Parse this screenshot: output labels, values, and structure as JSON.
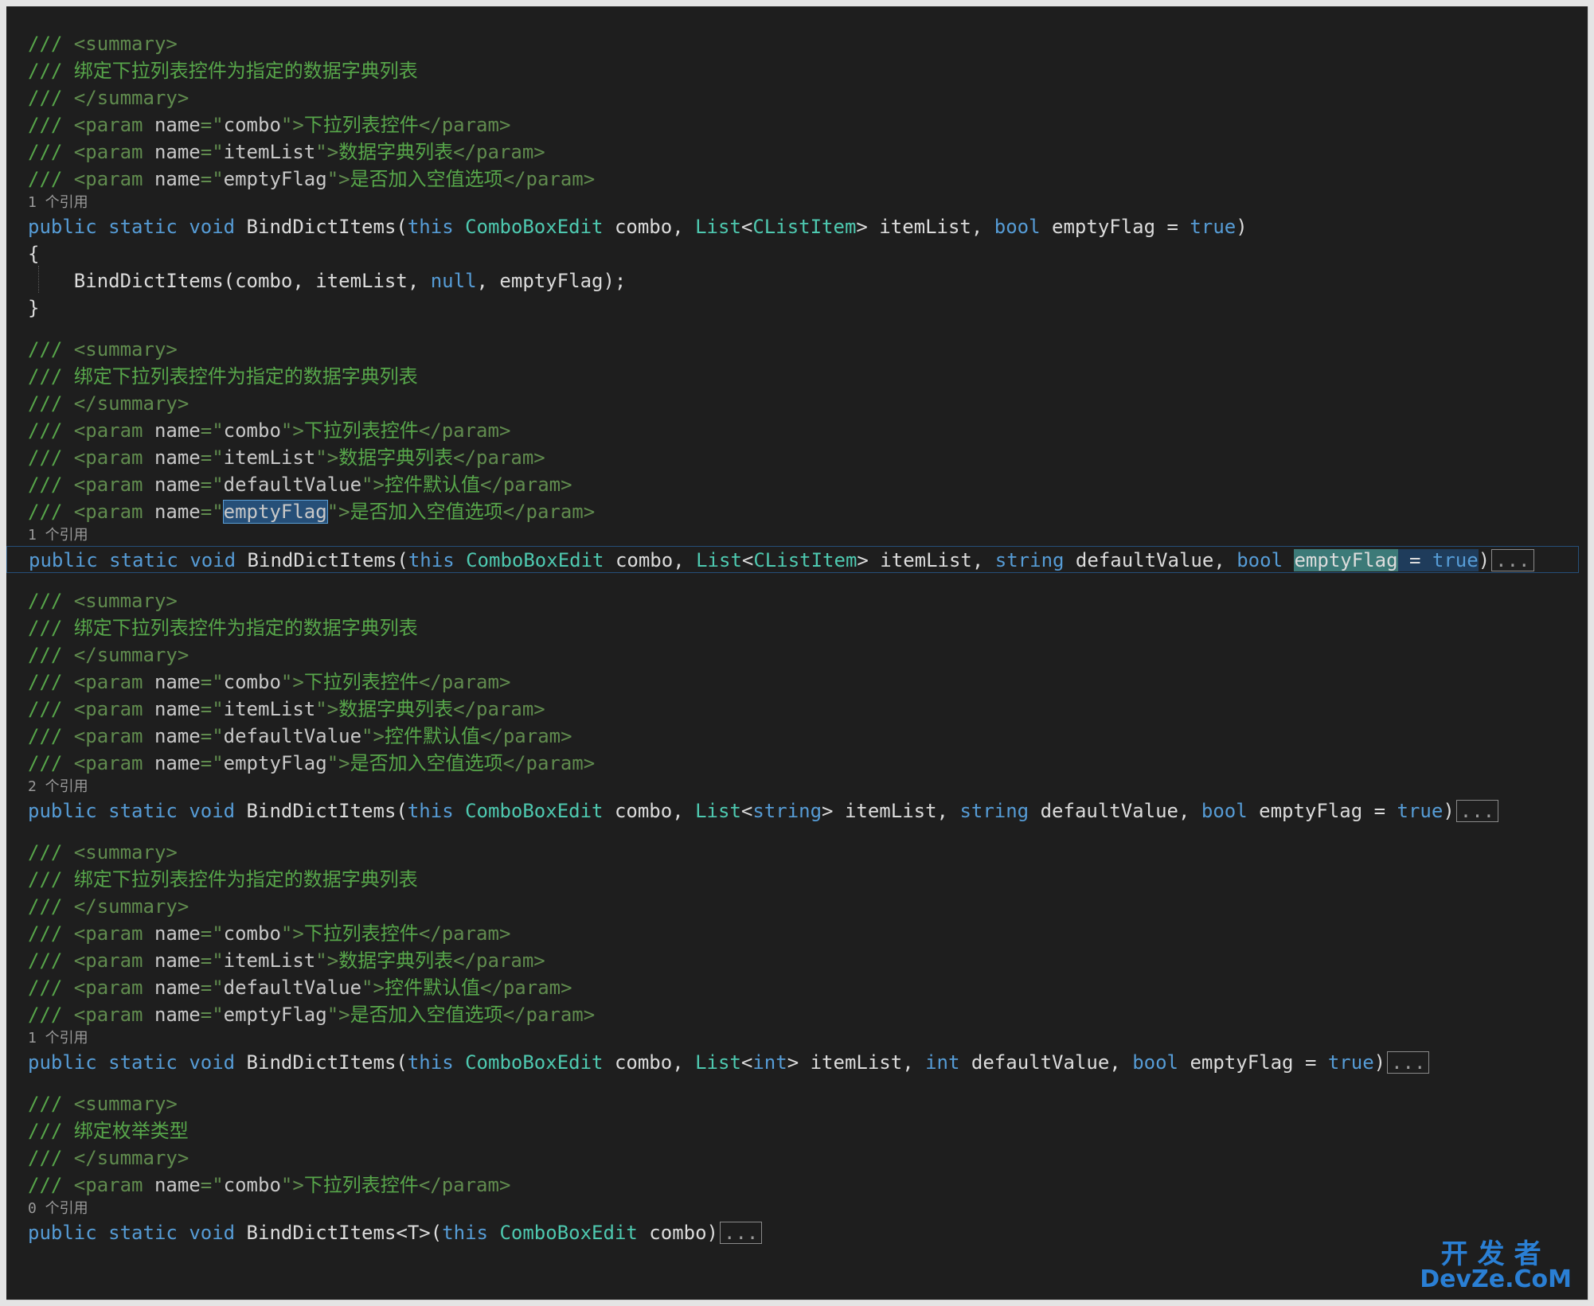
{
  "code_lines": [
    {
      "tokens": [
        [
          "c-comment",
          "/// "
        ],
        [
          "c-xmltag",
          "<summary>"
        ]
      ]
    },
    {
      "tokens": [
        [
          "c-comment",
          "/// 绑定下拉列表控件为指定的数据字典列表"
        ]
      ]
    },
    {
      "tokens": [
        [
          "c-comment",
          "/// "
        ],
        [
          "c-xmltag",
          "</summary>"
        ]
      ]
    },
    {
      "tokens": [
        [
          "c-comment",
          "/// "
        ],
        [
          "c-xmltag",
          "<param "
        ],
        [
          "c-attrname",
          "name"
        ],
        [
          "c-xmltag",
          "=\""
        ],
        [
          "c-attrval",
          "combo"
        ],
        [
          "c-xmltag",
          "\">"
        ],
        [
          "c-comment",
          "下拉列表控件"
        ],
        [
          "c-xmltag",
          "</param>"
        ]
      ]
    },
    {
      "tokens": [
        [
          "c-comment",
          "/// "
        ],
        [
          "c-xmltag",
          "<param "
        ],
        [
          "c-attrname",
          "name"
        ],
        [
          "c-xmltag",
          "=\""
        ],
        [
          "c-attrval",
          "itemList"
        ],
        [
          "c-xmltag",
          "\">"
        ],
        [
          "c-comment",
          "数据字典列表"
        ],
        [
          "c-xmltag",
          "</param>"
        ]
      ]
    },
    {
      "tokens": [
        [
          "c-comment",
          "/// "
        ],
        [
          "c-xmltag",
          "<param "
        ],
        [
          "c-attrname",
          "name"
        ],
        [
          "c-xmltag",
          "=\""
        ],
        [
          "c-attrval",
          "emptyFlag"
        ],
        [
          "c-xmltag",
          "\">"
        ],
        [
          "c-comment",
          "是否加入空值选项"
        ],
        [
          "c-xmltag",
          "</param>"
        ]
      ]
    },
    {
      "lens": "1 个引用"
    },
    {
      "tokens": [
        [
          "c-keyword",
          "public"
        ],
        [
          "c-ident",
          " "
        ],
        [
          "c-keyword",
          "static"
        ],
        [
          "c-ident",
          " "
        ],
        [
          "c-keyword",
          "void"
        ],
        [
          "c-ident",
          " BindDictItems("
        ],
        [
          "c-keyword",
          "this"
        ],
        [
          "c-ident",
          " "
        ],
        [
          "c-type",
          "ComboBoxEdit"
        ],
        [
          "c-ident",
          " combo, "
        ],
        [
          "c-type",
          "List"
        ],
        [
          "c-ident",
          "<"
        ],
        [
          "c-type",
          "CListItem"
        ],
        [
          "c-ident",
          "> itemList, "
        ],
        [
          "c-keyword",
          "bool"
        ],
        [
          "c-ident",
          " emptyFlag = "
        ],
        [
          "c-keyword",
          "true"
        ],
        [
          "c-ident",
          ")"
        ]
      ]
    },
    {
      "tokens": [
        [
          "c-ident",
          "{"
        ]
      ]
    },
    {
      "tokens": [
        [
          "c-ident",
          "    BindDictItems(combo, itemList, "
        ],
        [
          "c-keyword",
          "null"
        ],
        [
          "c-ident",
          ", emptyFlag);"
        ]
      ]
    },
    {
      "tokens": [
        [
          "c-ident",
          "}"
        ]
      ]
    },
    {
      "blank": true
    },
    {
      "tokens": [
        [
          "c-comment",
          "/// "
        ],
        [
          "c-xmltag",
          "<summary>"
        ]
      ]
    },
    {
      "tokens": [
        [
          "c-comment",
          "/// 绑定下拉列表控件为指定的数据字典列表"
        ]
      ]
    },
    {
      "tokens": [
        [
          "c-comment",
          "/// "
        ],
        [
          "c-xmltag",
          "</summary>"
        ]
      ]
    },
    {
      "tokens": [
        [
          "c-comment",
          "/// "
        ],
        [
          "c-xmltag",
          "<param "
        ],
        [
          "c-attrname",
          "name"
        ],
        [
          "c-xmltag",
          "=\""
        ],
        [
          "c-attrval",
          "combo"
        ],
        [
          "c-xmltag",
          "\">"
        ],
        [
          "c-comment",
          "下拉列表控件"
        ],
        [
          "c-xmltag",
          "</param>"
        ]
      ]
    },
    {
      "tokens": [
        [
          "c-comment",
          "/// "
        ],
        [
          "c-xmltag",
          "<param "
        ],
        [
          "c-attrname",
          "name"
        ],
        [
          "c-xmltag",
          "=\""
        ],
        [
          "c-attrval",
          "itemList"
        ],
        [
          "c-xmltag",
          "\">"
        ],
        [
          "c-comment",
          "数据字典列表"
        ],
        [
          "c-xmltag",
          "</param>"
        ]
      ]
    },
    {
      "tokens": [
        [
          "c-comment",
          "/// "
        ],
        [
          "c-xmltag",
          "<param "
        ],
        [
          "c-attrname",
          "name"
        ],
        [
          "c-xmltag",
          "=\""
        ],
        [
          "c-attrval",
          "defaultValue"
        ],
        [
          "c-xmltag",
          "\">"
        ],
        [
          "c-comment",
          "控件默认值"
        ],
        [
          "c-xmltag",
          "</param>"
        ]
      ]
    },
    {
      "tokens": [
        [
          "c-comment",
          "/// "
        ],
        [
          "c-xmltag",
          "<param "
        ],
        [
          "c-attrname",
          "name"
        ],
        [
          "c-xmltag",
          "=\""
        ],
        [
          "c-attrval c-hl-word",
          "emptyFlag"
        ],
        [
          "c-xmltag",
          "\">"
        ],
        [
          "c-comment",
          "是否加入空值选项"
        ],
        [
          "c-xmltag",
          "</param>"
        ]
      ]
    },
    {
      "lens": "1 个引用"
    },
    {
      "highlight": true,
      "collapsed": "...",
      "tokens": [
        [
          "c-keyword",
          "public"
        ],
        [
          "c-ident",
          " "
        ],
        [
          "c-keyword",
          "static"
        ],
        [
          "c-ident",
          " "
        ],
        [
          "c-keyword",
          "void"
        ],
        [
          "c-ident",
          " BindDictItems("
        ],
        [
          "c-keyword",
          "this"
        ],
        [
          "c-ident",
          " "
        ],
        [
          "c-type",
          "ComboBoxEdit"
        ],
        [
          "c-ident",
          " combo, "
        ],
        [
          "c-type",
          "List"
        ],
        [
          "c-ident",
          "<"
        ],
        [
          "c-type",
          "CListItem"
        ],
        [
          "c-ident",
          "> itemList, "
        ],
        [
          "c-keyword",
          "string"
        ],
        [
          "c-ident",
          " defaultValue, "
        ],
        [
          "c-keyword",
          "bool"
        ],
        [
          "c-ident",
          " "
        ],
        [
          "c-ident c-hl-def",
          "emptyFlag"
        ],
        [
          "c-ident c-hl-sel",
          " = "
        ],
        [
          "c-keyword c-hl-sel",
          "true"
        ],
        [
          "c-ident",
          ")"
        ]
      ]
    },
    {
      "blank": true
    },
    {
      "tokens": [
        [
          "c-comment",
          "/// "
        ],
        [
          "c-xmltag",
          "<summary>"
        ]
      ]
    },
    {
      "tokens": [
        [
          "c-comment",
          "/// 绑定下拉列表控件为指定的数据字典列表"
        ]
      ]
    },
    {
      "tokens": [
        [
          "c-comment",
          "/// "
        ],
        [
          "c-xmltag",
          "</summary>"
        ]
      ]
    },
    {
      "tokens": [
        [
          "c-comment",
          "/// "
        ],
        [
          "c-xmltag",
          "<param "
        ],
        [
          "c-attrname",
          "name"
        ],
        [
          "c-xmltag",
          "=\""
        ],
        [
          "c-attrval",
          "combo"
        ],
        [
          "c-xmltag",
          "\">"
        ],
        [
          "c-comment",
          "下拉列表控件"
        ],
        [
          "c-xmltag",
          "</param>"
        ]
      ]
    },
    {
      "tokens": [
        [
          "c-comment",
          "/// "
        ],
        [
          "c-xmltag",
          "<param "
        ],
        [
          "c-attrname",
          "name"
        ],
        [
          "c-xmltag",
          "=\""
        ],
        [
          "c-attrval",
          "itemList"
        ],
        [
          "c-xmltag",
          "\">"
        ],
        [
          "c-comment",
          "数据字典列表"
        ],
        [
          "c-xmltag",
          "</param>"
        ]
      ]
    },
    {
      "tokens": [
        [
          "c-comment",
          "/// "
        ],
        [
          "c-xmltag",
          "<param "
        ],
        [
          "c-attrname",
          "name"
        ],
        [
          "c-xmltag",
          "=\""
        ],
        [
          "c-attrval",
          "defaultValue"
        ],
        [
          "c-xmltag",
          "\">"
        ],
        [
          "c-comment",
          "控件默认值"
        ],
        [
          "c-xmltag",
          "</param>"
        ]
      ]
    },
    {
      "tokens": [
        [
          "c-comment",
          "/// "
        ],
        [
          "c-xmltag",
          "<param "
        ],
        [
          "c-attrname",
          "name"
        ],
        [
          "c-xmltag",
          "=\""
        ],
        [
          "c-attrval",
          "emptyFlag"
        ],
        [
          "c-xmltag",
          "\">"
        ],
        [
          "c-comment",
          "是否加入空值选项"
        ],
        [
          "c-xmltag",
          "</param>"
        ]
      ]
    },
    {
      "lens": "2 个引用"
    },
    {
      "collapsed": "...",
      "tokens": [
        [
          "c-keyword",
          "public"
        ],
        [
          "c-ident",
          " "
        ],
        [
          "c-keyword",
          "static"
        ],
        [
          "c-ident",
          " "
        ],
        [
          "c-keyword",
          "void"
        ],
        [
          "c-ident",
          " BindDictItems("
        ],
        [
          "c-keyword",
          "this"
        ],
        [
          "c-ident",
          " "
        ],
        [
          "c-type",
          "ComboBoxEdit"
        ],
        [
          "c-ident",
          " combo, "
        ],
        [
          "c-type",
          "List"
        ],
        [
          "c-ident",
          "<"
        ],
        [
          "c-keyword",
          "string"
        ],
        [
          "c-ident",
          "> itemList, "
        ],
        [
          "c-keyword",
          "string"
        ],
        [
          "c-ident",
          " defaultValue, "
        ],
        [
          "c-keyword",
          "bool"
        ],
        [
          "c-ident",
          " emptyFlag = "
        ],
        [
          "c-keyword",
          "true"
        ],
        [
          "c-ident",
          ")"
        ]
      ]
    },
    {
      "blank": true
    },
    {
      "tokens": [
        [
          "c-comment",
          "/// "
        ],
        [
          "c-xmltag",
          "<summary>"
        ]
      ]
    },
    {
      "tokens": [
        [
          "c-comment",
          "/// 绑定下拉列表控件为指定的数据字典列表"
        ]
      ]
    },
    {
      "tokens": [
        [
          "c-comment",
          "/// "
        ],
        [
          "c-xmltag",
          "</summary>"
        ]
      ]
    },
    {
      "tokens": [
        [
          "c-comment",
          "/// "
        ],
        [
          "c-xmltag",
          "<param "
        ],
        [
          "c-attrname",
          "name"
        ],
        [
          "c-xmltag",
          "=\""
        ],
        [
          "c-attrval",
          "combo"
        ],
        [
          "c-xmltag",
          "\">"
        ],
        [
          "c-comment",
          "下拉列表控件"
        ],
        [
          "c-xmltag",
          "</param>"
        ]
      ]
    },
    {
      "tokens": [
        [
          "c-comment",
          "/// "
        ],
        [
          "c-xmltag",
          "<param "
        ],
        [
          "c-attrname",
          "name"
        ],
        [
          "c-xmltag",
          "=\""
        ],
        [
          "c-attrval",
          "itemList"
        ],
        [
          "c-xmltag",
          "\">"
        ],
        [
          "c-comment",
          "数据字典列表"
        ],
        [
          "c-xmltag",
          "</param>"
        ]
      ]
    },
    {
      "tokens": [
        [
          "c-comment",
          "/// "
        ],
        [
          "c-xmltag",
          "<param "
        ],
        [
          "c-attrname",
          "name"
        ],
        [
          "c-xmltag",
          "=\""
        ],
        [
          "c-attrval",
          "defaultValue"
        ],
        [
          "c-xmltag",
          "\">"
        ],
        [
          "c-comment",
          "控件默认值"
        ],
        [
          "c-xmltag",
          "</param>"
        ]
      ]
    },
    {
      "tokens": [
        [
          "c-comment",
          "/// "
        ],
        [
          "c-xmltag",
          "<param "
        ],
        [
          "c-attrname",
          "name"
        ],
        [
          "c-xmltag",
          "=\""
        ],
        [
          "c-attrval",
          "emptyFlag"
        ],
        [
          "c-xmltag",
          "\">"
        ],
        [
          "c-comment",
          "是否加入空值选项"
        ],
        [
          "c-xmltag",
          "</param>"
        ]
      ]
    },
    {
      "lens": "1 个引用"
    },
    {
      "collapsed": "...",
      "tokens": [
        [
          "c-keyword",
          "public"
        ],
        [
          "c-ident",
          " "
        ],
        [
          "c-keyword",
          "static"
        ],
        [
          "c-ident",
          " "
        ],
        [
          "c-keyword",
          "void"
        ],
        [
          "c-ident",
          " BindDictItems("
        ],
        [
          "c-keyword",
          "this"
        ],
        [
          "c-ident",
          " "
        ],
        [
          "c-type",
          "ComboBoxEdit"
        ],
        [
          "c-ident",
          " combo, "
        ],
        [
          "c-type",
          "List"
        ],
        [
          "c-ident",
          "<"
        ],
        [
          "c-keyword",
          "int"
        ],
        [
          "c-ident",
          "> itemList, "
        ],
        [
          "c-keyword",
          "int"
        ],
        [
          "c-ident",
          " defaultValue, "
        ],
        [
          "c-keyword",
          "bool"
        ],
        [
          "c-ident",
          " emptyFlag = "
        ],
        [
          "c-keyword",
          "true"
        ],
        [
          "c-ident",
          ")"
        ]
      ]
    },
    {
      "blank": true
    },
    {
      "tokens": [
        [
          "c-comment",
          "/// "
        ],
        [
          "c-xmltag",
          "<summary>"
        ]
      ]
    },
    {
      "tokens": [
        [
          "c-comment",
          "/// 绑定枚举类型"
        ]
      ]
    },
    {
      "tokens": [
        [
          "c-comment",
          "/// "
        ],
        [
          "c-xmltag",
          "</summary>"
        ]
      ]
    },
    {
      "tokens": [
        [
          "c-comment",
          "/// "
        ],
        [
          "c-xmltag",
          "<param "
        ],
        [
          "c-attrname",
          "name"
        ],
        [
          "c-xmltag",
          "=\""
        ],
        [
          "c-attrval",
          "combo"
        ],
        [
          "c-xmltag",
          "\">"
        ],
        [
          "c-comment",
          "下拉列表控件"
        ],
        [
          "c-xmltag",
          "</param>"
        ]
      ]
    },
    {
      "lens": "0 个引用"
    },
    {
      "collapsed": "...",
      "tokens": [
        [
          "c-keyword",
          "public"
        ],
        [
          "c-ident",
          " "
        ],
        [
          "c-keyword",
          "static"
        ],
        [
          "c-ident",
          " "
        ],
        [
          "c-keyword",
          "void"
        ],
        [
          "c-ident",
          " BindDictItems<T>("
        ],
        [
          "c-keyword",
          "this"
        ],
        [
          "c-ident",
          " "
        ],
        [
          "c-type",
          "ComboBoxEdit"
        ],
        [
          "c-ident",
          " combo)"
        ]
      ]
    }
  ],
  "watermark": {
    "cn": "开发者",
    "en": "DevZe.CoM"
  },
  "colors": {
    "background": "#1e1e1e",
    "comment": "#57a64a",
    "keyword": "#569cd6",
    "type": "#4ec9b0",
    "text": "#dcdcdc"
  }
}
